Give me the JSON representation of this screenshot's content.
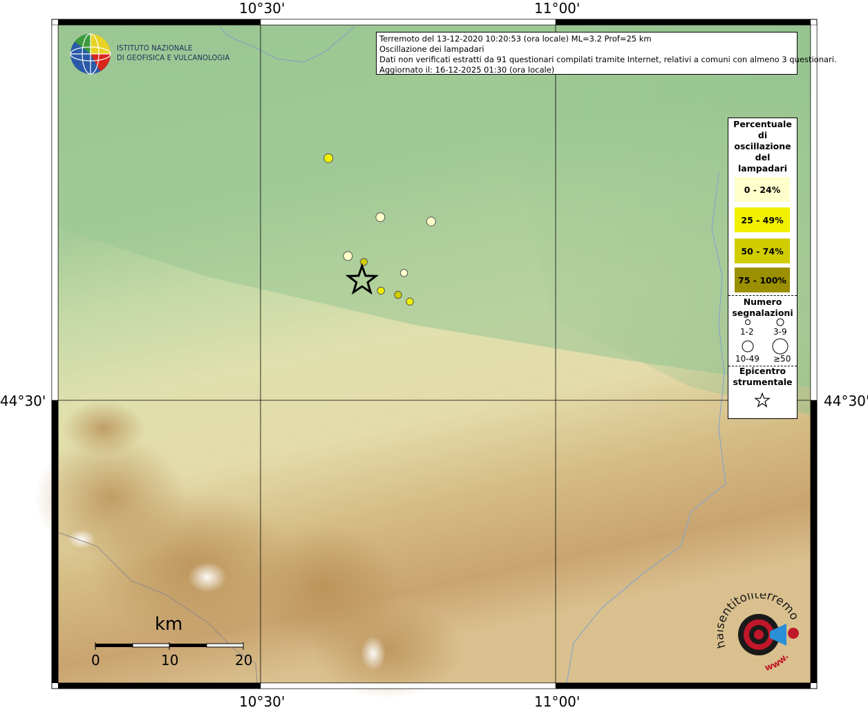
{
  "header": {
    "line1": "Terremoto del 13-12-2020 10:20:53 (ora locale) ML=3.2 Prof=25 km",
    "line2": "Oscillazione dei lampadari",
    "line3": "Dati non verificati estratti da 91 questionari compilati tramite Internet, relativi a comuni con almeno 3 questionari.",
    "line4": "Aggiornato il: 16-12-2025 01:30 (ora locale)"
  },
  "logo": {
    "line1": "ISTITUTO NAZIONALE",
    "line2": "DI GEOFISICA E VULCANOLOGIA"
  },
  "axes": {
    "top": [
      "10°30'",
      "11°00'"
    ],
    "bottom": [
      "10°30'",
      "11°00'"
    ],
    "left": "44°30'",
    "right": "44°30'"
  },
  "legend": {
    "title": [
      "Percentuale",
      "di",
      "oscillazione",
      "del",
      "lampadari"
    ],
    "classes": [
      {
        "label": "0 - 24%",
        "color": "#ffffcc"
      },
      {
        "label": "25 - 49%",
        "color": "#f0f000"
      },
      {
        "label": "50 - 74%",
        "color": "#d0cc00"
      },
      {
        "label": "75 - 100%",
        "color": "#9b9000"
      }
    ],
    "size_title": [
      "Numero",
      "segnalazioni"
    ],
    "sizes": [
      "1-2",
      "3-9",
      "10-49",
      "≥50"
    ],
    "epicenter_title": [
      "Epicentro",
      "strumentale"
    ]
  },
  "points": [
    {
      "lon": 10.615,
      "lat": 44.787,
      "class": 1
    },
    {
      "lon": 10.703,
      "lat": 44.717,
      "class": 0
    },
    {
      "lon": 10.789,
      "lat": 44.712,
      "class": 0
    },
    {
      "lon": 10.648,
      "lat": 44.671,
      "class": 0
    },
    {
      "lon": 10.675,
      "lat": 44.664,
      "class": 2
    },
    {
      "lon": 10.743,
      "lat": 44.651,
      "class": 0
    },
    {
      "lon": 10.704,
      "lat": 44.63,
      "class": 1
    },
    {
      "lon": 10.733,
      "lat": 44.625,
      "class": 2
    },
    {
      "lon": 10.753,
      "lat": 44.617,
      "class": 1
    }
  ],
  "epicenter": {
    "lon": 10.672,
    "lat": 44.642
  },
  "scale": {
    "title": "km",
    "ticks": [
      "0",
      "10",
      "20"
    ]
  },
  "corner_logo": {
    "text": "haisentitoilterremoto.it",
    "www": "www."
  }
}
